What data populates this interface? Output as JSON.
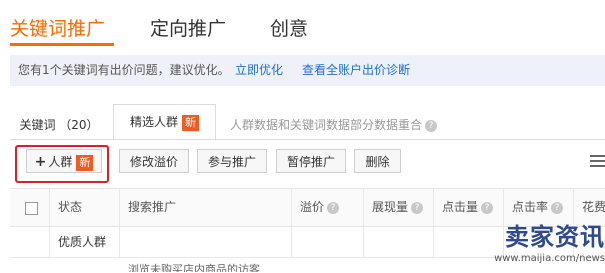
{
  "top_tabs": [
    {
      "label": "关键词推广",
      "active": true
    },
    {
      "label": "定向推广",
      "active": false
    },
    {
      "label": "创意",
      "active": false
    }
  ],
  "notice": {
    "text": "您有1个关键词有出价问题，建议优化。",
    "link1": "立即优化",
    "link2": "查看全账户出价诊断"
  },
  "sub_tabs": {
    "keywords": "关键词 （20）",
    "crowd": "精选人群",
    "crowd_badge": "新",
    "hint": "人群数据和关键词数据部分数据重合"
  },
  "toolbar": {
    "add_label": "人群",
    "add_badge": "新",
    "modify_premium": "修改溢价",
    "join_promo": "参与推广",
    "pause_promo": "暂停推广",
    "delete": "删除"
  },
  "table": {
    "headers": {
      "status": "状态",
      "search_promo": "搜索推广",
      "premium": "溢价",
      "impressions": "展现量",
      "clicks": "点击量",
      "ctr": "点击率",
      "cost": "花费"
    },
    "rows": [
      {
        "status": "优质人群",
        "search_promo": ""
      }
    ],
    "partial_row_text": "浏览未购买店内商品的访客"
  },
  "watermark": {
    "title": "卖家资讯",
    "url": "www.maijia.com/news"
  },
  "colors": {
    "accent": "#ff6a00",
    "link": "#1a6fd6",
    "badge": "#f15a22",
    "highlight": "#e02020"
  }
}
